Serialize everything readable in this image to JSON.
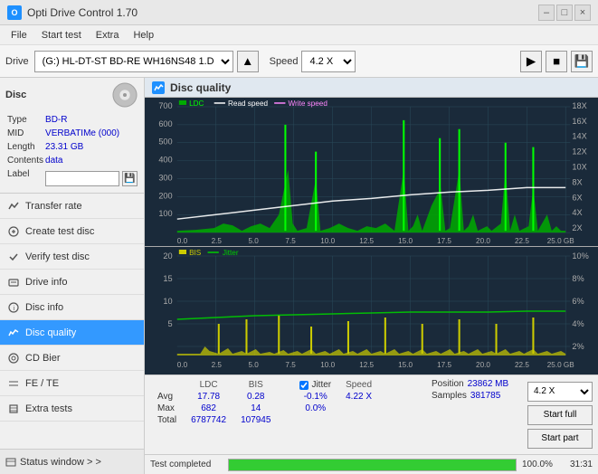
{
  "titlebar": {
    "title": "Opti Drive Control 1.70",
    "min_label": "–",
    "max_label": "□",
    "close_label": "×"
  },
  "menubar": {
    "items": [
      "File",
      "Start test",
      "Extra",
      "Help"
    ]
  },
  "toolbar": {
    "drive_label": "Drive",
    "drive_value": "(G:)  HL-DT-ST BD-RE  WH16NS48 1.D3",
    "speed_label": "Speed",
    "speed_value": "4.2 X"
  },
  "disc": {
    "type_label": "Type",
    "type_value": "BD-R",
    "mid_label": "MID",
    "mid_value": "VERBATIMe (000)",
    "length_label": "Length",
    "length_value": "23.31 GB",
    "contents_label": "Contents",
    "contents_value": "data",
    "label_label": "Label",
    "label_placeholder": ""
  },
  "nav": {
    "items": [
      {
        "id": "transfer-rate",
        "label": "Transfer rate",
        "active": false
      },
      {
        "id": "create-test-disc",
        "label": "Create test disc",
        "active": false
      },
      {
        "id": "verify-test-disc",
        "label": "Verify test disc",
        "active": false
      },
      {
        "id": "drive-info",
        "label": "Drive info",
        "active": false
      },
      {
        "id": "disc-info",
        "label": "Disc info",
        "active": false
      },
      {
        "id": "disc-quality",
        "label": "Disc quality",
        "active": true
      },
      {
        "id": "cd-bier",
        "label": "CD Bier",
        "active": false
      },
      {
        "id": "fe-te",
        "label": "FE / TE",
        "active": false
      },
      {
        "id": "extra-tests",
        "label": "Extra tests",
        "active": false
      }
    ]
  },
  "status_window": {
    "label": "Status window > >"
  },
  "quality_panel": {
    "title": "Disc quality"
  },
  "chart1": {
    "legend": [
      "LDC",
      "Read speed",
      "Write speed"
    ],
    "y_axis_left": [
      "700",
      "600",
      "500",
      "400",
      "300",
      "200",
      "100"
    ],
    "y_axis_right": [
      "18X",
      "16X",
      "14X",
      "12X",
      "10X",
      "8X",
      "6X",
      "4X",
      "2X"
    ],
    "x_axis": [
      "0.0",
      "2.5",
      "5.0",
      "7.5",
      "10.0",
      "12.5",
      "15.0",
      "17.5",
      "20.0",
      "22.5",
      "25.0 GB"
    ]
  },
  "chart2": {
    "legend": [
      "BIS",
      "Jitter"
    ],
    "y_axis_left": [
      "20",
      "15",
      "10",
      "5"
    ],
    "y_axis_right": [
      "10%",
      "8%",
      "6%",
      "4%",
      "2%"
    ],
    "x_axis": [
      "0.0",
      "2.5",
      "5.0",
      "7.5",
      "10.0",
      "12.5",
      "15.0",
      "17.5",
      "20.0",
      "22.5",
      "25.0 GB"
    ]
  },
  "stats": {
    "headers": [
      "LDC",
      "BIS",
      "",
      "Jitter",
      "Speed",
      ""
    ],
    "avg_label": "Avg",
    "avg_ldc": "17.78",
    "avg_bis": "0.28",
    "avg_jitter": "-0.1%",
    "avg_speed": "4.22 X",
    "max_label": "Max",
    "max_ldc": "682",
    "max_bis": "14",
    "max_jitter": "0.0%",
    "total_label": "Total",
    "total_ldc": "6787742",
    "total_bis": "107945",
    "jitter_checked": true,
    "jitter_label": "Jitter",
    "position_label": "Position",
    "position_value": "23862 MB",
    "samples_label": "Samples",
    "samples_value": "381785",
    "speed_select": "4.2 X",
    "btn_start_full": "Start full",
    "btn_start_part": "Start part"
  },
  "progress": {
    "fill_pct": 100,
    "label": "100.0%",
    "time": "31:31"
  },
  "bottom_status": {
    "text": "Test completed"
  }
}
